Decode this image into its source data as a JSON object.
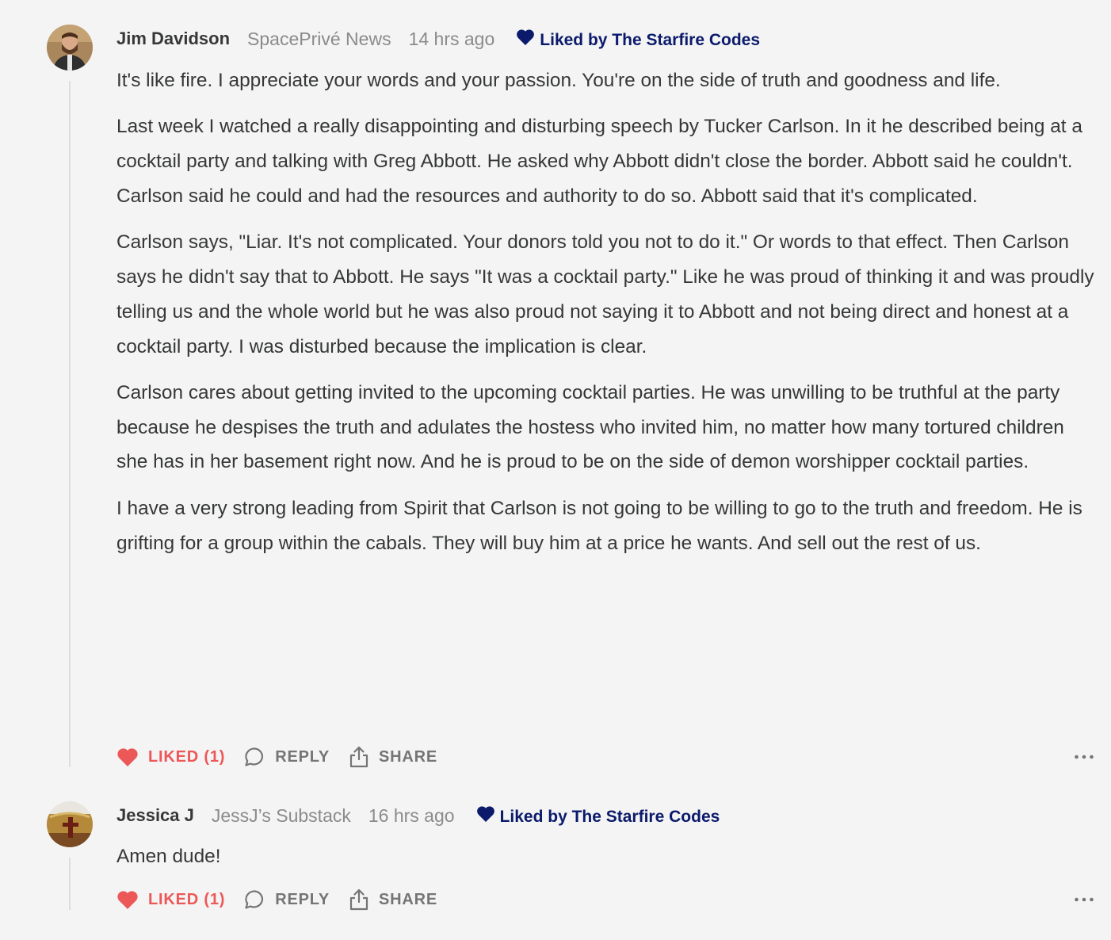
{
  "comments": [
    {
      "author": "Jim Davidson",
      "publication": "SpacePrivé News",
      "time": "14 hrs ago",
      "liked_by": "Liked by The Starfire Codes",
      "paragraphs": [
        "It's like fire. I appreciate your words and your passion. You're on the side of truth and goodness and life.",
        "Last week I watched a really disappointing and disturbing speech by Tucker Carlson. In it he described being at a cocktail party and talking with Greg Abbott. He asked why Abbott didn't close the border. Abbott said he couldn't. Carlson said he could and had the resources and authority to do so. Abbott said that it's complicated.",
        "Carlson says, \"Liar. It's not complicated. Your donors told you not to do it.\" Or words to that effect. Then Carlson says he didn't say that to Abbott. He says \"It was a cocktail party.\" Like he was proud of thinking it and was proudly telling us and the whole world but he was also proud not saying it to Abbott and not being direct and honest at a cocktail party. I was disturbed because the implication is clear.",
        "Carlson cares about getting invited to the upcoming cocktail parties. He was unwilling to be truthful at the party because he despises the truth and adulates the hostess who invited him, no matter how many tortured children she has in her basement right now. And he is proud to be on the side of demon worshipper cocktail parties.",
        "I have a very strong leading from Spirit that Carlson is not going to be willing to go to the truth and freedom. He is grifting for a group within the cabals. They will buy him at a price he wants. And sell out the rest of us."
      ],
      "actions": {
        "like": "LIKED (1)",
        "reply": "REPLY",
        "share": "SHARE"
      }
    },
    {
      "author": "Jessica J",
      "publication": "JessJ’s Substack",
      "time": "16 hrs ago",
      "liked_by": "Liked by The Starfire Codes",
      "paragraphs": [
        "Amen dude!"
      ],
      "actions": {
        "like": "LIKED (1)",
        "reply": "REPLY",
        "share": "SHARE"
      }
    }
  ],
  "colors": {
    "background": "#f4f4f4",
    "text": "#363737",
    "muted": "#8b8b8b",
    "liked": "#ec5757",
    "liked_by": "#0b1a6b",
    "thread_line": "#dddddd"
  },
  "icons": {
    "liked_by": "heart-filled-navy-icon",
    "like": "heart-filled-red-icon",
    "reply": "speech-bubble-icon",
    "share": "share-upload-icon",
    "more": "ellipsis-icon"
  }
}
